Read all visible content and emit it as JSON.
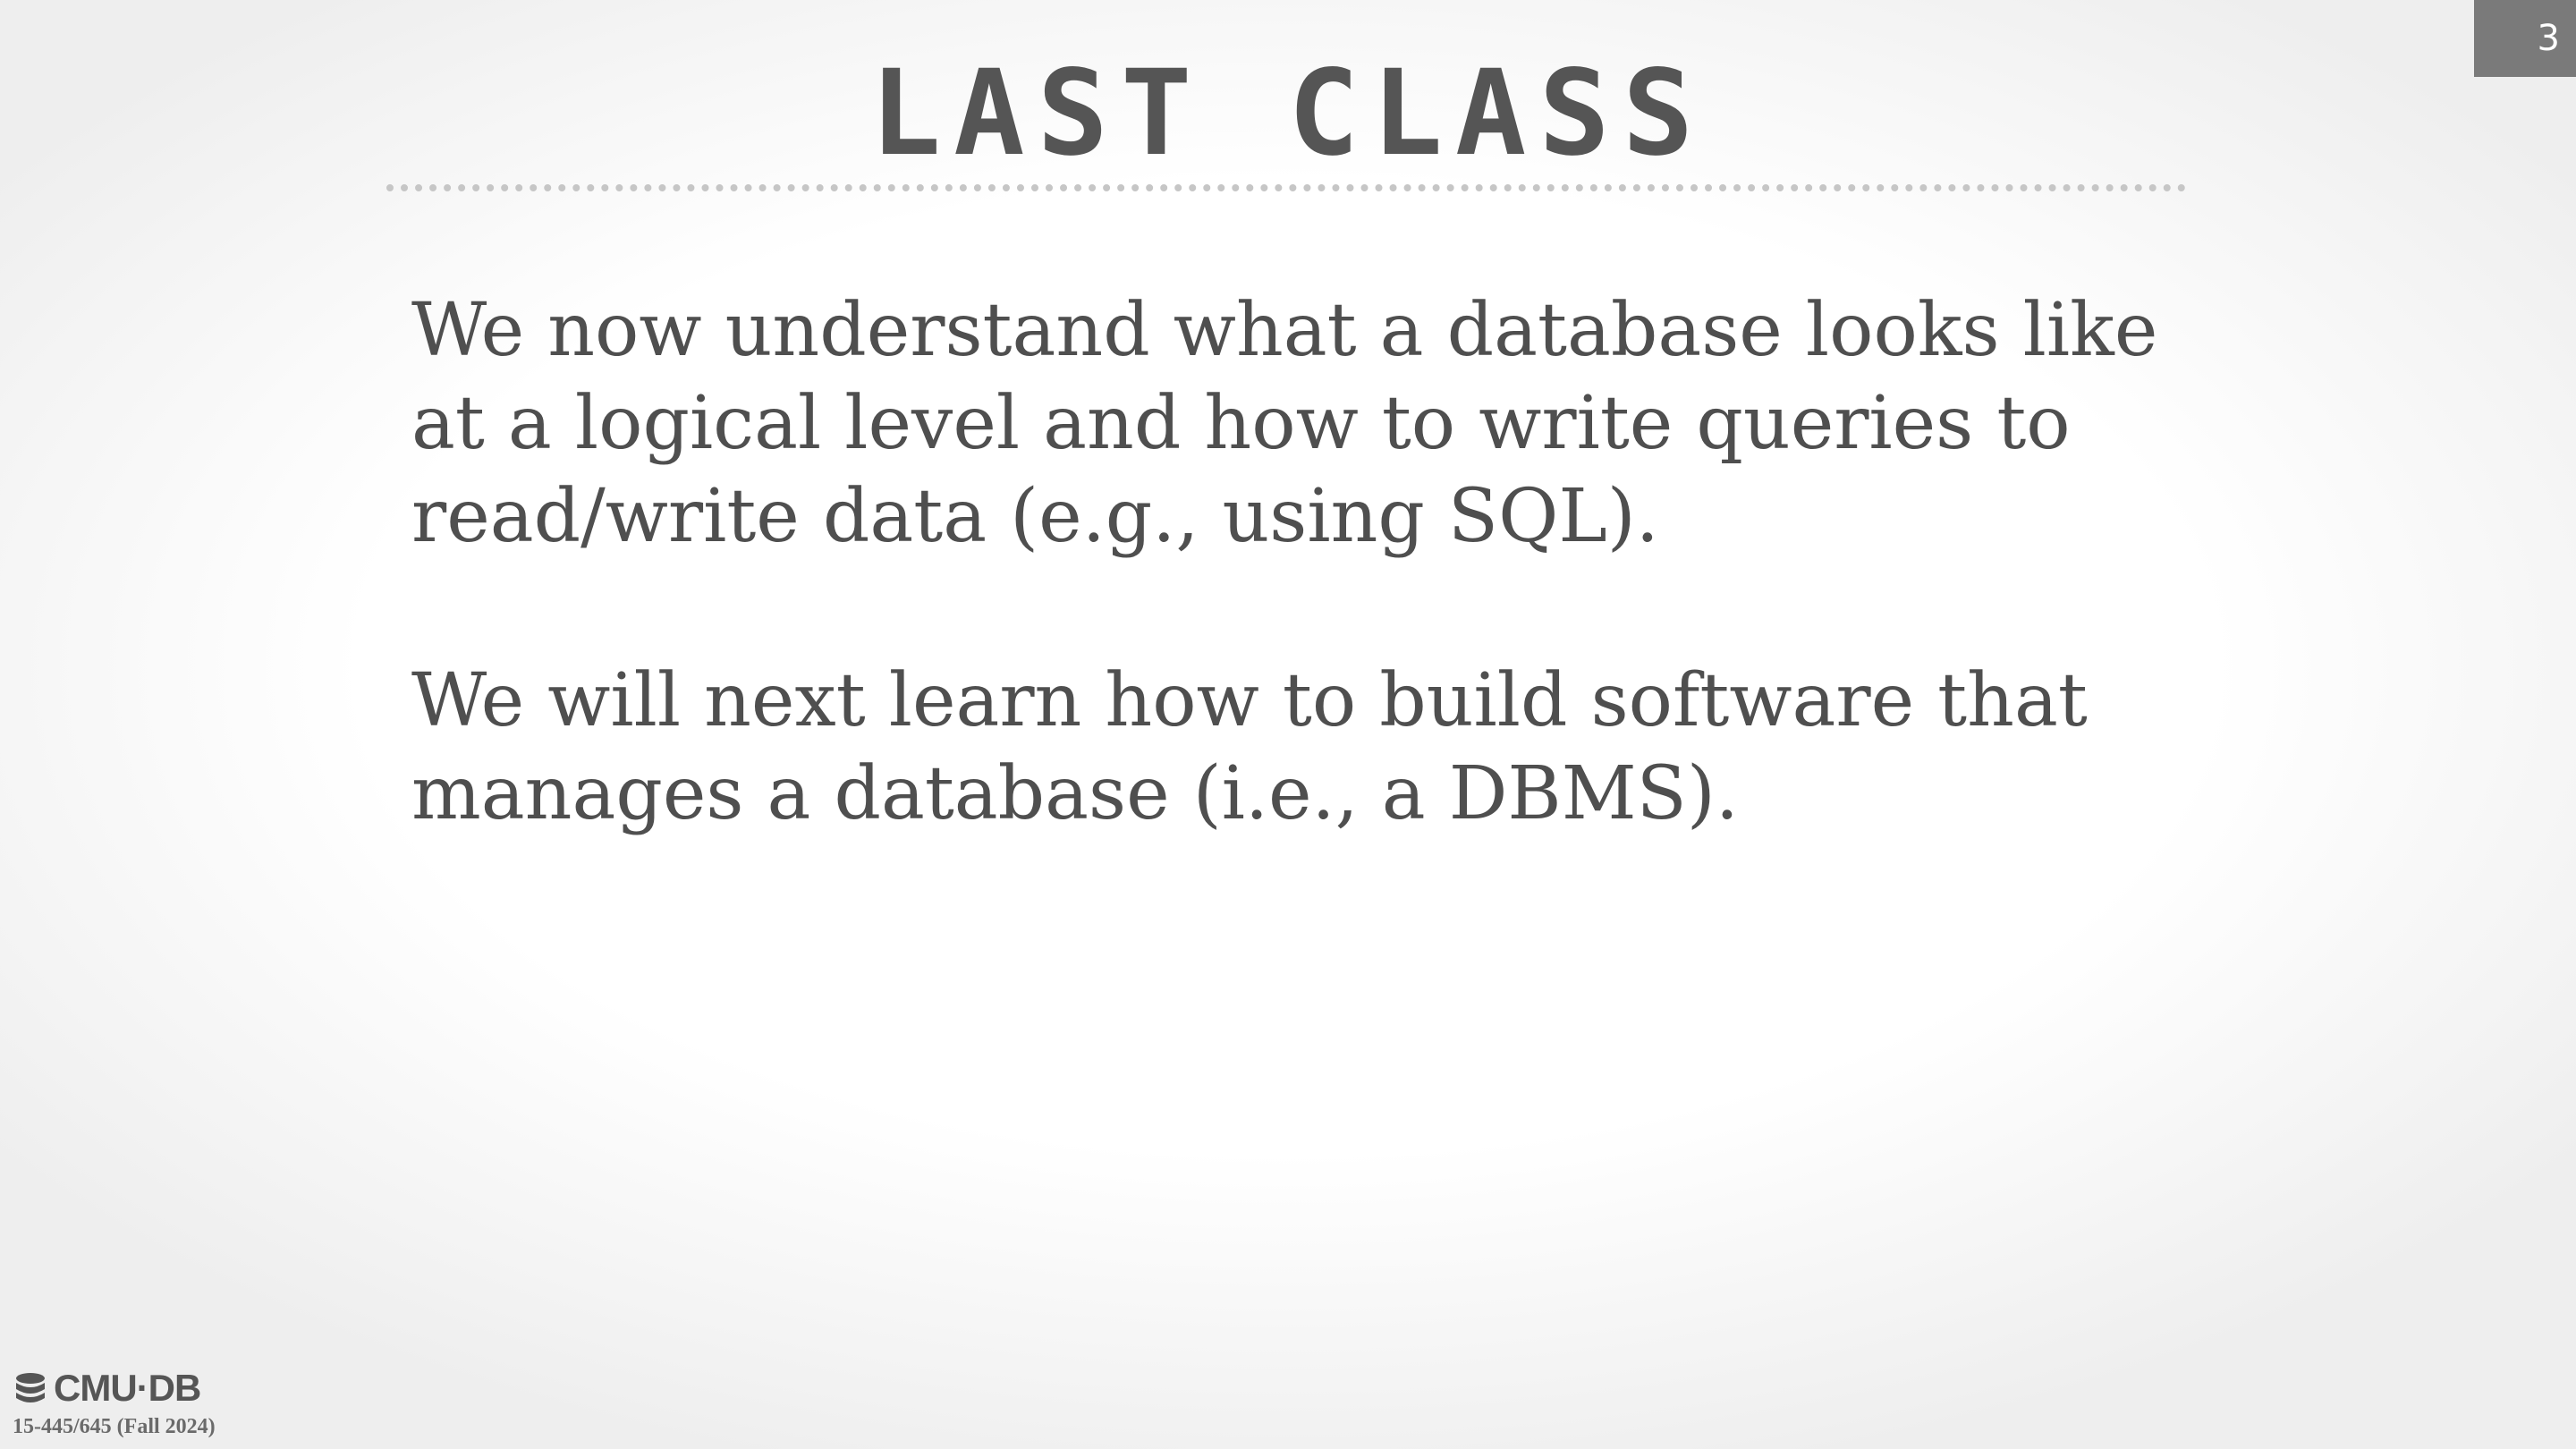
{
  "slide": {
    "page_number": "3",
    "title": "LAST CLASS",
    "paragraphs": [
      "We now understand what a database looks like at a logical level and how to write queries to read/write data (e.g., using SQL).",
      "We will next learn how to build software that manages a database (i.e., a DBMS)."
    ]
  },
  "footer": {
    "logo_text": "CMU·DB",
    "logo_icon": "database-icon",
    "course": "15-445/645 (Fall 2024)"
  },
  "colors": {
    "text": "#4f4f4f",
    "title": "#555555",
    "page_badge": "#7a7a7a"
  }
}
